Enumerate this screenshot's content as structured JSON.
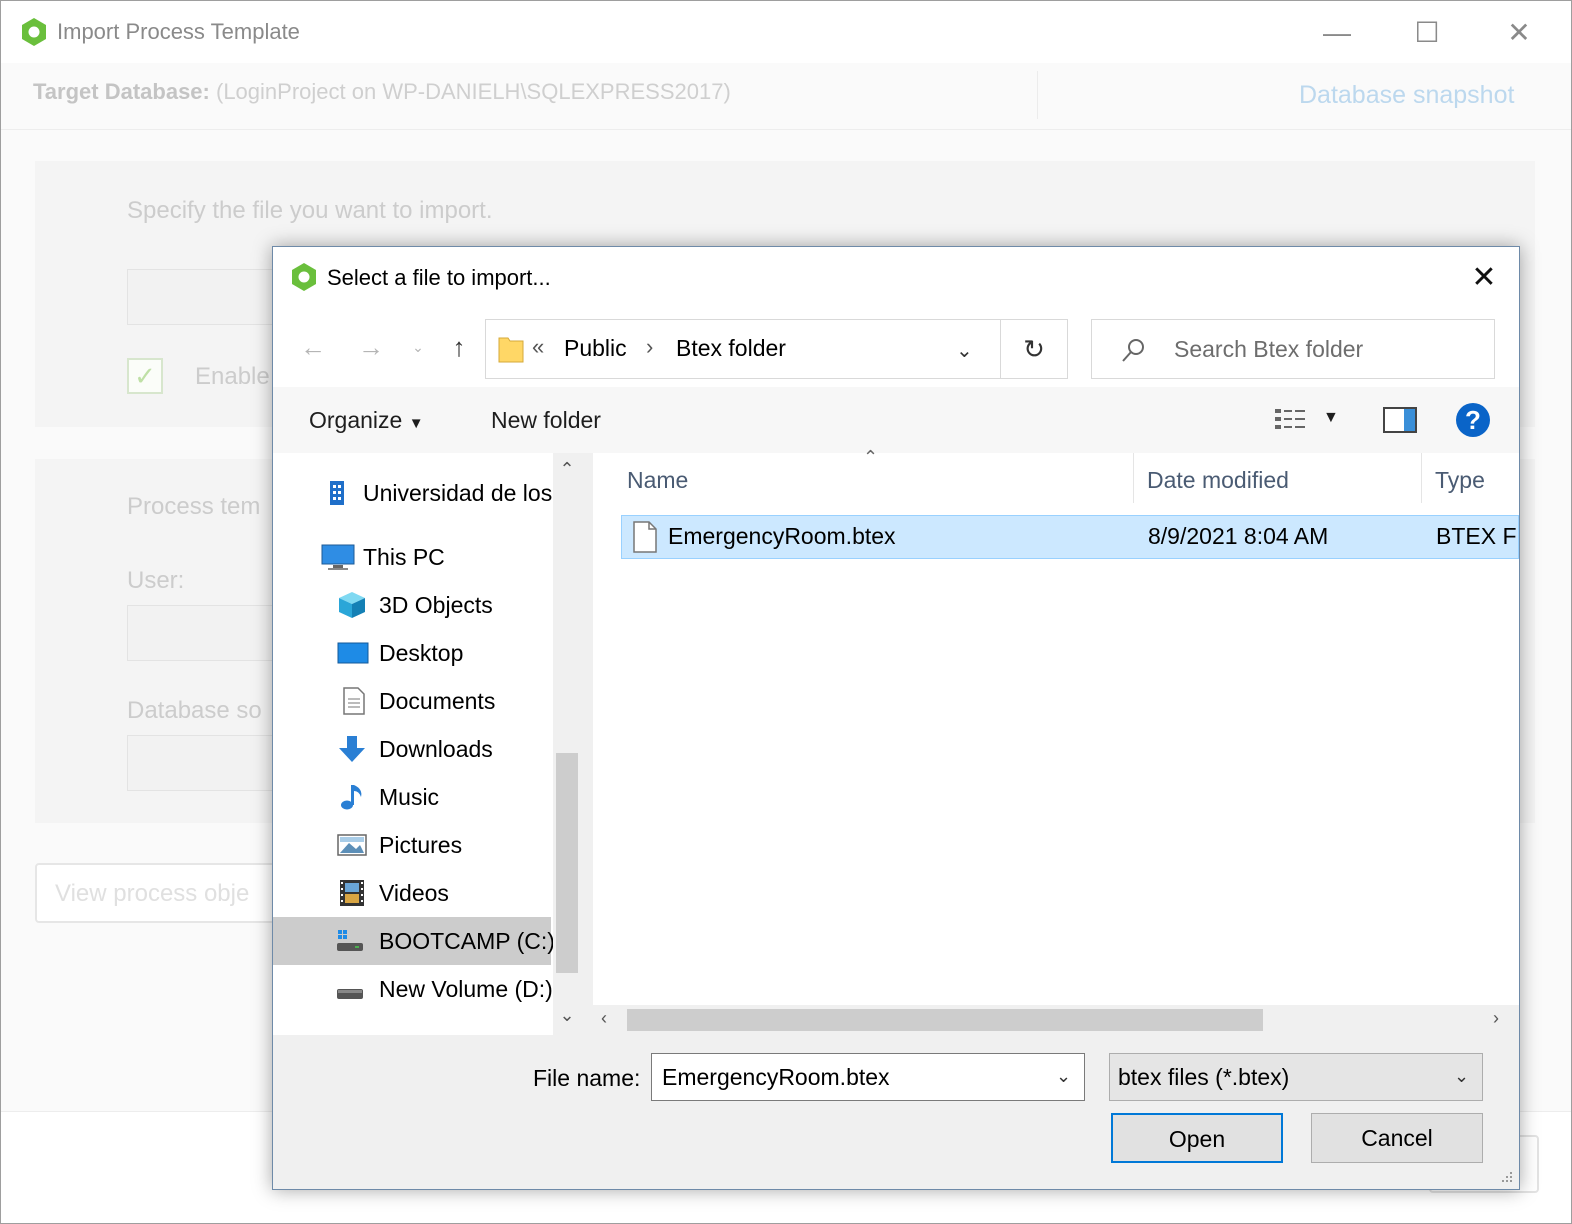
{
  "background_window": {
    "title": "Import Process Template",
    "target_label": "Target Database:",
    "target_value": "(LoginProject on WP-DANIELH\\SQLEXPRESS2017)",
    "snapshot_link": "Database snapshot",
    "specify_text": "Specify the file you want to import.",
    "enable_text": "Enable",
    "process_text": "Process tem",
    "user_label": "User:",
    "database_text": "Database so",
    "view_button": "View process obje"
  },
  "dialog": {
    "title": "Select a file to import...",
    "address": {
      "overflow": "«",
      "crumbs": [
        "Public",
        "Btex folder"
      ],
      "separator": "›"
    },
    "search_placeholder": "Search Btex folder",
    "toolbar": {
      "organize": "Organize",
      "new_folder": "New folder"
    },
    "nav_items": [
      {
        "label": "Universidad de los"
      },
      {
        "label": "This PC"
      },
      {
        "label": "3D Objects"
      },
      {
        "label": "Desktop"
      },
      {
        "label": "Documents"
      },
      {
        "label": "Downloads"
      },
      {
        "label": "Music"
      },
      {
        "label": "Pictures"
      },
      {
        "label": "Videos"
      },
      {
        "label": "BOOTCAMP (C:)"
      },
      {
        "label": "New Volume (D:)"
      }
    ],
    "columns": {
      "name": "Name",
      "date_modified": "Date modified",
      "type": "Type"
    },
    "files": [
      {
        "name": "EmergencyRoom.btex",
        "date": "8/9/2021 8:04 AM",
        "type": "BTEX File"
      }
    ],
    "file_name_label": "File name:",
    "file_name_value": "EmergencyRoom.btex",
    "file_type": "btex files (*.btex)",
    "open_button": "Open",
    "cancel_button": "Cancel"
  },
  "colors": {
    "accent": "#0078d7",
    "selection": "#cce8ff",
    "help": "#0a64c8",
    "brand_green": "#6abf3c"
  }
}
